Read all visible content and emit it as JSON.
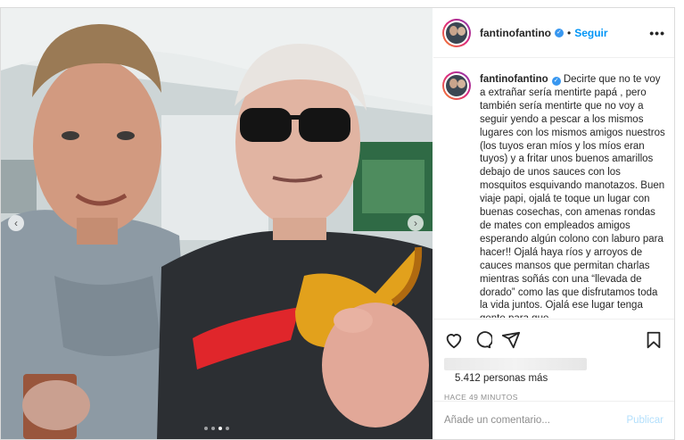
{
  "post": {
    "username": "fantinofantino",
    "follow_label": "Seguir",
    "separator": "•",
    "more_glyph": "•••",
    "verified_glyph": "✓",
    "caption": "Decirte que no te voy a extrañar sería mentirte papá , pero también sería mentirte que no voy a seguir yendo a pescar a los mismos lugares con los mismos amigos nuestros (los tuyos eran míos y los míos eran tuyos) y a fritar unos buenos amarillos debajo de unos sauces con los mosquitos esquivando manotazos. Buen viaje papi, ojalá te toque un lugar con buenas cosechas, con amenas rondas de mates con empleados amigos esperando algún colono con laburo para hacer!! Ojalá haya ríos y arroyos de cauces mansos que permitan charlas mientras soñás con una “llevada de dorado” como las que disfrutamos toda la vida juntos. Ojalá ese lugar tenga gente para que",
    "likes": "5.412 personas más",
    "time": "HACE 49 MINUTOS",
    "comment_placeholder": "Añade un comentario...",
    "publish_label": "Publicar",
    "carousel": {
      "total": 4,
      "active": 3
    }
  },
  "icons": [
    "heart-icon",
    "comment-icon",
    "share-icon",
    "bookmark-icon",
    "chevron-left-icon",
    "chevron-right-icon",
    "more-icon",
    "verified-icon"
  ],
  "colors": {
    "accent": "#0095f6",
    "publish_disabled": "#b2dffc",
    "verified": "#3897f0"
  }
}
